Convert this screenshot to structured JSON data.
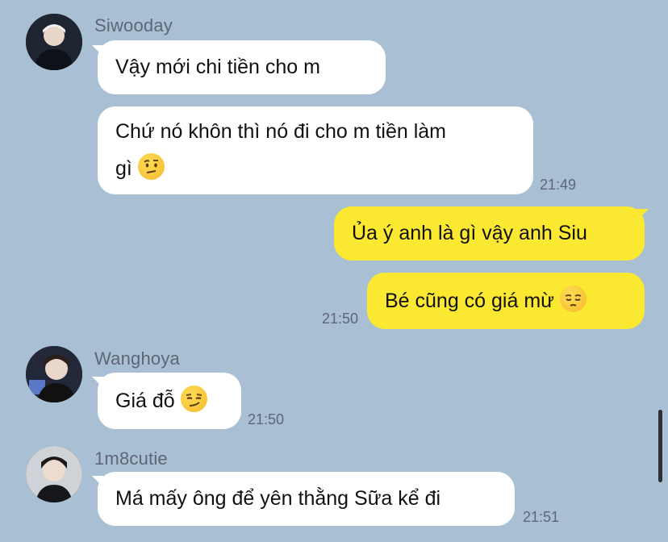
{
  "messages": [
    {
      "sender": "Siwooday",
      "text": "Vậy mới chi tiền cho m"
    },
    {
      "text_line1": "Chứ nó khôn thì nó đi cho m tiền làm",
      "text_line2": "gì",
      "time": "21:49"
    },
    {
      "text": "Ủa ý anh là gì vậy anh Siu"
    },
    {
      "text": "Bé cũng có giá mừ",
      "time": "21:50"
    },
    {
      "sender": "Wanghoya",
      "text": "Giá đỗ",
      "time": "21:50"
    },
    {
      "sender": "1m8cutie",
      "text": "Má mấy ông để yên thằng Sữa kể đi",
      "time": "21:51"
    }
  ],
  "emojis": [
    "raised-eyebrow-emoji",
    "pensive-emoji",
    "smirk-emoji"
  ],
  "colors": {
    "background": "#a9bfd4",
    "incoming_bubble": "#ffffff",
    "outgoing_bubble": "#fbe831"
  }
}
